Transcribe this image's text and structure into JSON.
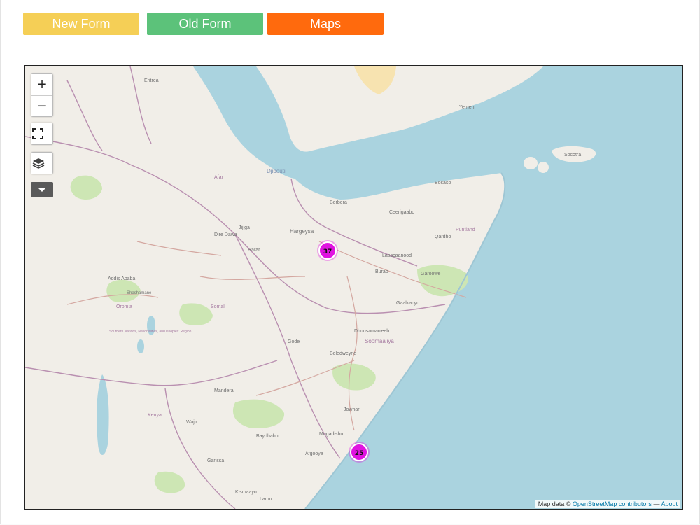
{
  "nav": {
    "new_form": {
      "label": "New Form",
      "color": "#f5cf56"
    },
    "old_form": {
      "label": "Old Form",
      "color": "#5cc27a"
    },
    "maps": {
      "label": "Maps",
      "color": "#ff6a0d"
    }
  },
  "map": {
    "controls": {
      "zoom_in": "+",
      "zoom_out": "−",
      "fullscreen_icon": "fullscreen-icon",
      "layers_icon": "layers-icon",
      "dropdown_icon": "caret-down-icon"
    },
    "markers": [
      {
        "count": "37"
      },
      {
        "count": "25"
      }
    ],
    "marker_color": "#e014e0",
    "attribution": {
      "prefix": "Map data ©",
      "osm_link": "OpenStreetMap contributors",
      "separator": "—",
      "about_link": "About"
    },
    "place_labels": {
      "hargeysa": "Hargeysa",
      "berbera": "Berbera",
      "djibouti": "Djibouti",
      "burao": "Burao",
      "laascaanood": "Laascaanood",
      "erigavo": "Ceerigaabo",
      "bosaso": "Bosaso",
      "qardho": "Qardho",
      "garoowe": "Garoowe",
      "galkacyo": "Gaalkacyo",
      "dhusamareb": "Dhuusamarreeb",
      "beledweyne": "Beledweyne",
      "mogadishu": "Mogadishu",
      "baidoa": "Baydhabo",
      "kismayo": "Kismaayo",
      "afgooye": "Afgooye",
      "jowhar": "Jowhar",
      "somalia": "Soomaaliya",
      "addis": "Addis Ababa",
      "shashamane": "Shashamane",
      "dire_dawa": "Dire Dawa",
      "harar": "Harar",
      "jijiga": "Jijiga",
      "gode": "Gode",
      "eritrea": "Eritrea",
      "yemen": "Yemen",
      "afar": "Afar",
      "somali_region": "Somali",
      "oromia": "Oromia",
      "snnpr": "Southern Nations, Nationalities, and Peoples' Region",
      "puntland": "Puntland",
      "socotra": "Socotra",
      "kenya": "Kenya",
      "wajir": "Wajir",
      "mandera": "Mandera",
      "garissa": "Garissa",
      "lamu": "Lamu"
    }
  }
}
